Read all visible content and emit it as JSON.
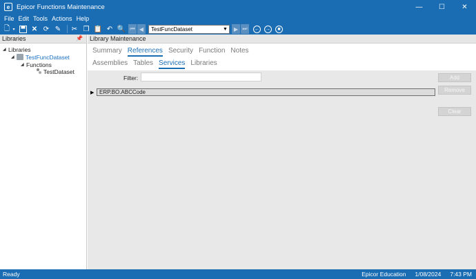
{
  "window": {
    "title": "Epicor Functions Maintenance",
    "app_icon_letter": "e",
    "controls": [
      "—",
      "☐",
      "✕"
    ]
  },
  "menu": [
    "File",
    "Edit",
    "Tools",
    "Actions",
    "Help"
  ],
  "toolbar": {
    "record_select": "TestFuncDataset",
    "icons": [
      "new-icon",
      "save-icon",
      "delete-icon",
      "refresh-icon",
      "clear-icon",
      "cut-icon",
      "copy-icon",
      "paste-icon",
      "undo-icon",
      "search-icon"
    ]
  },
  "left_panel": {
    "title": "Libraries",
    "tree": {
      "root": "Libraries",
      "library": "TestFuncDataset",
      "folder": "Functions",
      "function": "TestDataset"
    }
  },
  "main": {
    "title": "Library Maintenance",
    "tabs": [
      "Summary",
      "References",
      "Security",
      "Function",
      "Notes"
    ],
    "active_tab": "References",
    "subtabs": [
      "Assemblies",
      "Tables",
      "Services",
      "Libraries"
    ],
    "active_subtab": "Services",
    "filter_label": "Filter:",
    "filter_value": "",
    "rows": [
      "ERP.BO.ABCCode"
    ],
    "buttons": {
      "add": "Add",
      "remove": "Remove",
      "clear": "Clear"
    }
  },
  "status": {
    "left": "Ready",
    "company": "Epicor Education",
    "date": "1/08/2024",
    "time": "7:43 PM"
  },
  "colors": {
    "accent": "#1b6db3",
    "link": "#1a6fc0",
    "content_bg": "#e8e8e8"
  }
}
